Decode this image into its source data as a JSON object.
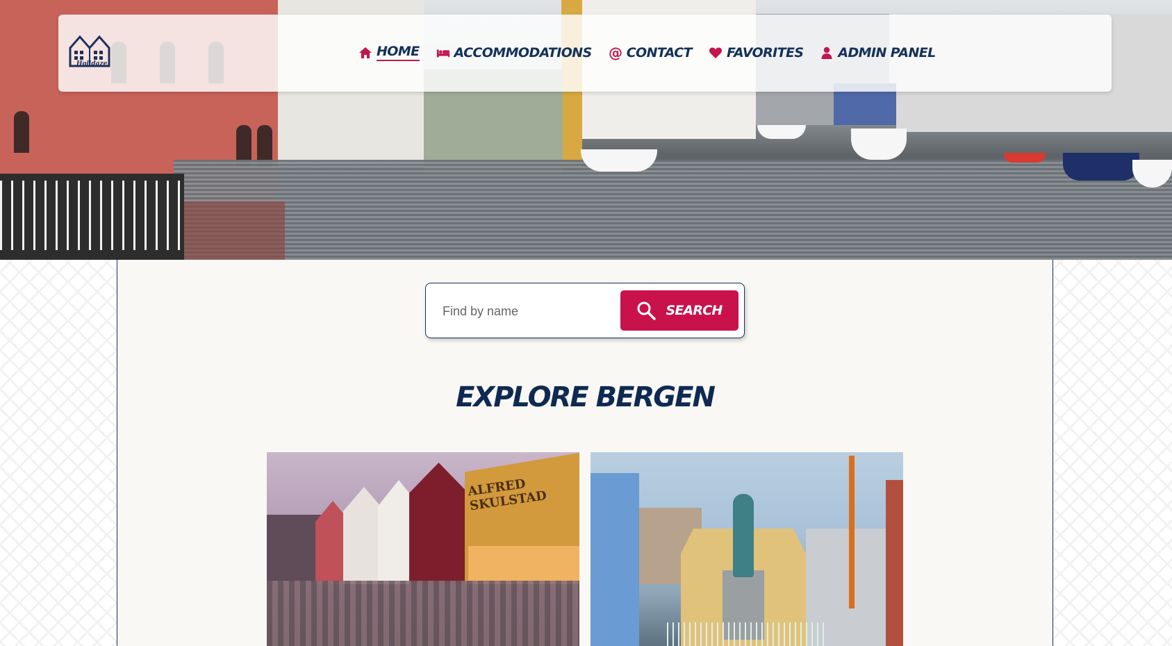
{
  "nav": {
    "logo_text": "Holidaze",
    "items": [
      {
        "label": "Home",
        "icon": "home-icon",
        "active": true
      },
      {
        "label": "Accommodations",
        "icon": "bed-icon",
        "active": false
      },
      {
        "label": "Contact",
        "icon": "at-icon",
        "active": false
      },
      {
        "label": "Favorites",
        "icon": "heart-icon",
        "active": false
      },
      {
        "label": "Admin Panel",
        "icon": "user-icon",
        "active": false
      }
    ]
  },
  "search": {
    "placeholder": "Find by name",
    "value": "",
    "button_label": "Search"
  },
  "section": {
    "title": "Explore Bergen"
  },
  "cards": [
    {
      "sign_text": "ALFRED SKULSTAD"
    },
    {}
  ],
  "colors": {
    "accent": "#c9114c",
    "navy": "#14315a",
    "content_bg": "#f9f8f5"
  }
}
